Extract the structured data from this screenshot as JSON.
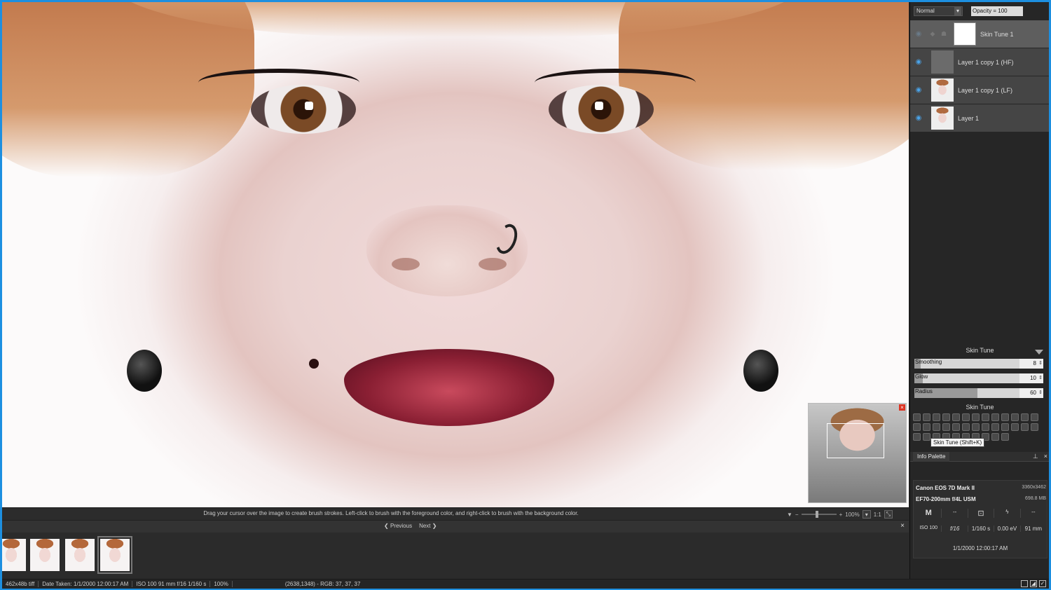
{
  "canvas": {
    "hint": "Drag your cursor over the image to create brush strokes. Left-click to brush with the foreground color, and right-click to brush with the background color.",
    "zoom": "100%",
    "one_to_one": "1:1"
  },
  "browser": {
    "previous": "Previous",
    "next": "Next"
  },
  "status": {
    "file": "462x48b tiff",
    "date": "Date Taken: 1/1/2000 12:00:17 AM",
    "exposure": "ISO 100   91 mm   f/16   1/160 s",
    "zoom": "100%",
    "coords": "(2638,1348) - RGB: 37, 37, 37"
  },
  "layers": {
    "blend_mode": "Normal",
    "opacity": "Opacity = 100",
    "items": [
      {
        "name": "Skin Tune 1"
      },
      {
        "name": "Layer 1 copy 1 (HF)"
      },
      {
        "name": "Layer 1 copy 1 (LF)"
      },
      {
        "name": "Layer 1"
      }
    ]
  },
  "skin_tune": {
    "title": "Skin Tune",
    "sliders": [
      {
        "label": "Smoothing",
        "value": "8",
        "fraction": 0.06
      },
      {
        "label": "Glow",
        "value": "10",
        "fraction": 0.08
      },
      {
        "label": "Radius",
        "value": "60",
        "fraction": 0.6
      }
    ],
    "toolbox_title": "Skin Tune",
    "tooltip": "Skin Tune (Shift+K)"
  },
  "info": {
    "tab": "Info Palette",
    "camera": "Canon EOS 7D Mark II",
    "dimensions": "3360x3462",
    "lens": "EF70-200mm f/4L USM",
    "size": "698.8 MB",
    "mode": "M",
    "dash1": "--",
    "dash2": "--",
    "iso": "ISO 100",
    "aperture": "f/16",
    "shutter": "1/160 s",
    "ev": "0.00 eV",
    "focal": "91 mm",
    "datetime": "1/1/2000 12:00:17 AM"
  }
}
